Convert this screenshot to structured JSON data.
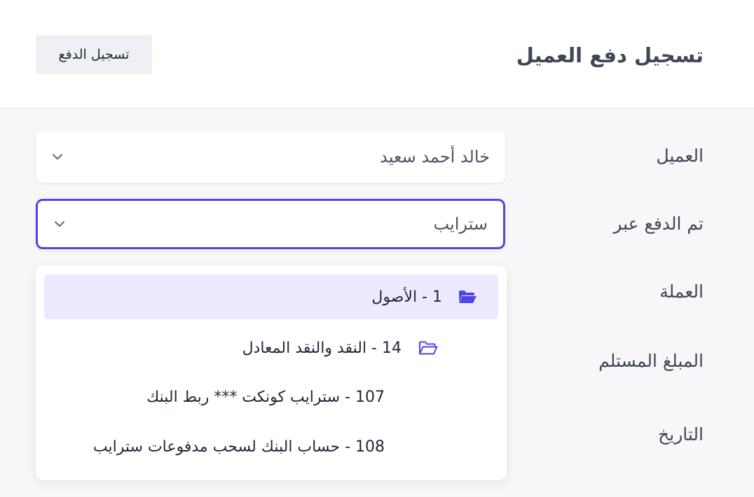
{
  "header": {
    "title": "تسجيل دفع العميل",
    "record_button": "تسجيل الدفع"
  },
  "form": {
    "client_label": "العميل",
    "client_value": "خالد أحمد سعيد",
    "paid_via_label": "تم الدفع عبر",
    "paid_via_value": "سترايب",
    "currency_label": "العملة",
    "amount_label": "المبلغ المستلم",
    "date_label": "التاريخ"
  },
  "dropdown": {
    "options": [
      {
        "label": "1 - الأصول",
        "icon": "folder-open-icon",
        "selected": true
      },
      {
        "label": "14 - النقد والنقد المعادل",
        "icon": "folder-open-icon"
      },
      {
        "label": "107 - سترايب كونكت *** ربط البنك"
      },
      {
        "label": "108 - حساب البنك لسحب مدفوعات سترايب"
      }
    ]
  },
  "colors": {
    "accent": "#4f46e5",
    "selected_bg": "#ede9fe",
    "folder_icon": "#4f46e5"
  }
}
